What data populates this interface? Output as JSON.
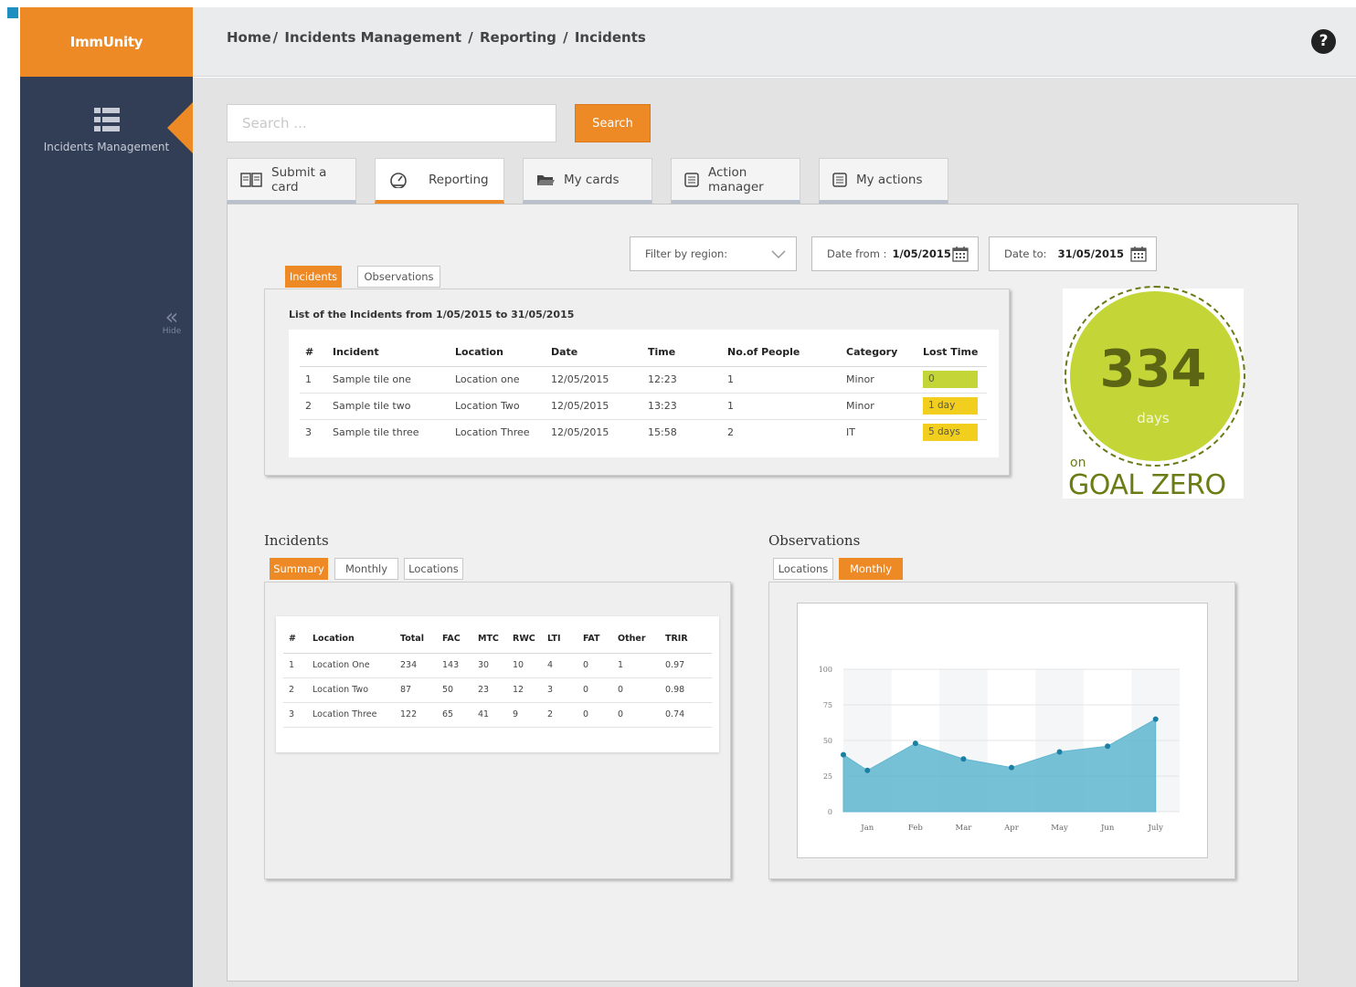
{
  "app": {
    "brand": "ImmUnity"
  },
  "sidebar": {
    "item_label": "Incidents Management",
    "hide_label": "Hide"
  },
  "breadcrumb": {
    "home": "Home",
    "sep1": "/",
    "section": "Incidents Management",
    "sep2": "/",
    "sub": "Reporting",
    "sep3": "/",
    "page": "Incidents"
  },
  "search": {
    "placeholder": "Search ...",
    "button_label": "Search"
  },
  "tabs": [
    {
      "label": "Submit a card",
      "icon": "book-icon"
    },
    {
      "label": "Reporting",
      "icon": "gauge-icon",
      "active": true
    },
    {
      "label": "My cards",
      "icon": "folder-icon"
    },
    {
      "label": "Action manager",
      "icon": "list-icon"
    },
    {
      "label": "My actions",
      "icon": "list-icon"
    }
  ],
  "filters": {
    "region_label": "Filter by region:",
    "date_from_label": "Date from :",
    "date_from_value": "1/05/2015",
    "date_to_label": "Date to:",
    "date_to_value": "31/05/2015"
  },
  "list_tabs": {
    "incidents": "Incidents",
    "observations": "Observations"
  },
  "incident_list": {
    "title": "List of the Incidents from 1/05/2015 to 31/05/2015",
    "columns": [
      "#",
      "Incident",
      "Location",
      "Date",
      "Time",
      "No.of People",
      "Category",
      "Lost Time"
    ],
    "rows": [
      {
        "num": "1",
        "incident": "Sample tile one",
        "location": "Location one",
        "date": "12/05/2015",
        "time": "12:23",
        "people": "1",
        "category": "Minor",
        "lost_time": "0",
        "lost_color": "#c3d537"
      },
      {
        "num": "2",
        "incident": "Sample tile two",
        "location": "Location Two",
        "date": "12/05/2015",
        "time": "13:23",
        "people": "1",
        "category": "Minor",
        "lost_time": "1 day",
        "lost_color": "#f2cf1f"
      },
      {
        "num": "3",
        "incident": "Sample tile three",
        "location": "Location Three",
        "date": "12/05/2015",
        "time": "15:58",
        "people": "2",
        "category": "IT",
        "lost_time": "5 days",
        "lost_color": "#f2cf1f"
      }
    ]
  },
  "goal": {
    "number": "334",
    "unit": "days",
    "on": "on",
    "title": "GOAL ZERO"
  },
  "incidents_section": {
    "title": "Incidents",
    "tabs": {
      "summary": "Summary",
      "monthly": "Monthly",
      "locations": "Locations"
    },
    "columns": [
      "#",
      "Location",
      "Total",
      "FAC",
      "MTC",
      "RWC",
      "LTI",
      "FAT",
      "Other",
      "TRIR"
    ],
    "rows": [
      [
        "1",
        "Location One",
        "234",
        "143",
        "30",
        "10",
        "4",
        "0",
        "1",
        "0.97"
      ],
      [
        "2",
        "Location Two",
        "87",
        "50",
        "23",
        "12",
        "3",
        "0",
        "0",
        "0.98"
      ],
      [
        "3",
        "Location Three",
        "122",
        "65",
        "41",
        "9",
        "2",
        "0",
        "0",
        "0.74"
      ]
    ]
  },
  "observations_section": {
    "title": "Observations",
    "tabs": {
      "locations": "Locations",
      "monthly": "Monthly"
    }
  },
  "chart_data": {
    "type": "area",
    "categories": [
      "Jan",
      "Feb",
      "Mar",
      "Apr",
      "May",
      "Jun",
      "July"
    ],
    "values": [
      40,
      29,
      48,
      37,
      31,
      42,
      46,
      65
    ],
    "x_positions": [
      -0.5,
      0,
      1,
      2,
      3,
      4,
      5,
      6
    ],
    "ylim": [
      0,
      100
    ],
    "yticks": [
      0,
      25,
      50,
      75,
      100
    ],
    "fill_color": "#5fb6d0",
    "point_color": "#1b7fa3",
    "grid": true
  },
  "colors": {
    "accent": "#ee8a26",
    "sidebar": "#323e55"
  }
}
